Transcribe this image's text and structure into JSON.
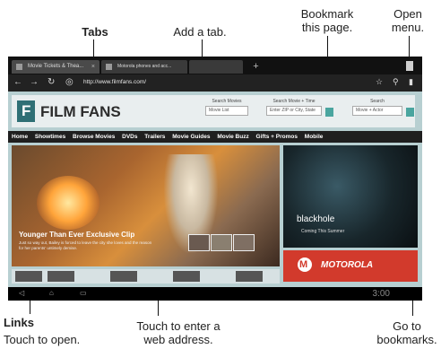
{
  "callouts": {
    "tabs": "Tabs",
    "add_tab": "Add a tab.",
    "bookmark": "Bookmark\nthis page.",
    "open_menu": "Open\nmenu.",
    "links_title": "Links",
    "links_desc": "Touch to open.",
    "address": "Touch to enter a\nweb address.",
    "bookmarks": "Go to\nbookmarks."
  },
  "browser": {
    "tabs": [
      {
        "label": "Movie Tickets & Thea...",
        "close": "×"
      },
      {
        "label": "Motorola phones and acc...",
        "close": ""
      }
    ],
    "new_tab_glyph": "+",
    "url": "http://www.filmfans.com/",
    "icons": [
      "back-icon",
      "forward-icon",
      "refresh-icon",
      "site-icon",
      "star-icon",
      "search-icon",
      "bookmarks-icon",
      "menu-icon"
    ]
  },
  "site": {
    "logo_letter": "F",
    "logo_text": "FILM FANS",
    "search_movies_label": "Search Movies",
    "movie_list": "Movie List",
    "search_time_label": "Search Movie + Time",
    "zip_placeholder": "Enter ZIP or City, State",
    "search_label": "Search",
    "movie_actor": "Movie + Actor",
    "nav": [
      "Home",
      "Showtimes",
      "Browse Movies",
      "DVDs",
      "Trailers",
      "Movie Guides",
      "Movie Buzz",
      "Gifts + Promos",
      "Mobile"
    ],
    "hero_title": "Younger Than Ever Exclusive Clip",
    "hero_desc": "Just so way out, Bailey is forced to leave the city she loves and the reason for her parents' untimely demise.",
    "promo_title": "blackhole",
    "promo_sub": "Coming This Summer",
    "ad_letter": "M",
    "ad_text": "MOTOROLA"
  },
  "system": {
    "time": "3:00"
  },
  "colors": {
    "accent": "#2f6f75",
    "page_bg": "#b7cfd1",
    "ad": "#d23a2c"
  }
}
